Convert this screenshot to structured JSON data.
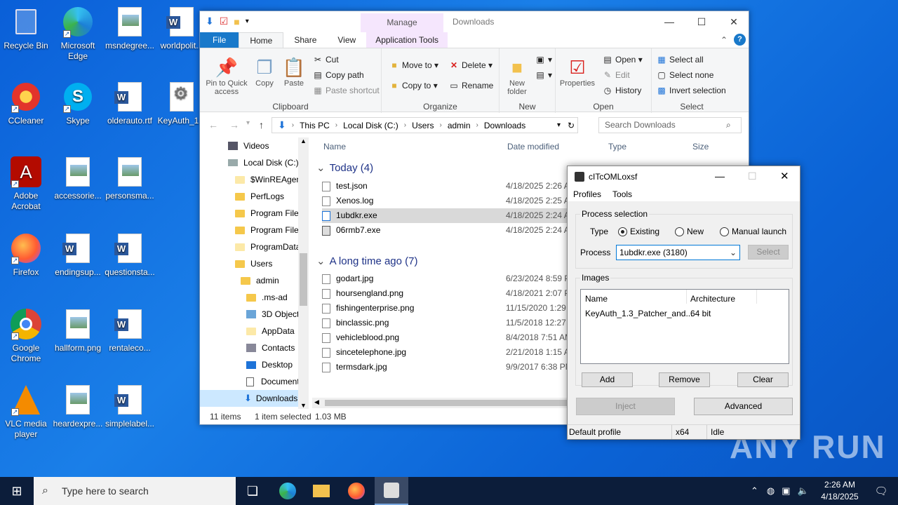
{
  "desktop": {
    "icons": [
      {
        "label": "Recycle Bin"
      },
      {
        "label": "Microsoft Edge"
      },
      {
        "label": "msndegree..."
      },
      {
        "label": "worldpolit..."
      },
      {
        "label": "CCleaner"
      },
      {
        "label": "Skype"
      },
      {
        "label": "olderauto.rtf"
      },
      {
        "label": "KeyAuth_1..."
      },
      {
        "label": "Adobe Acrobat"
      },
      {
        "label": "accessorie..."
      },
      {
        "label": "personsma..."
      },
      {
        "label": "Firefox"
      },
      {
        "label": "endingsup..."
      },
      {
        "label": "questionsta..."
      },
      {
        "label": "Google Chrome"
      },
      {
        "label": "hallform.png"
      },
      {
        "label": "rentaleco..."
      },
      {
        "label": "VLC media player"
      },
      {
        "label": "heardexpre..."
      },
      {
        "label": "simplelabel..."
      }
    ]
  },
  "explorer": {
    "title": "Downloads",
    "manage_tab": "Manage",
    "tabs": {
      "file": "File",
      "home": "Home",
      "share": "Share",
      "view": "View",
      "app_tools": "Application Tools"
    },
    "ribbon": {
      "pin": "Pin to Quick access",
      "copy": "Copy",
      "paste": "Paste",
      "cut": "Cut",
      "copy_path": "Copy path",
      "paste_shortcut": "Paste shortcut",
      "clipboard": "Clipboard",
      "move_to": "Move to",
      "copy_to": "Copy to",
      "delete": "Delete",
      "rename": "Rename",
      "organize": "Organize",
      "new_folder": "New folder",
      "new": "New",
      "properties": "Properties",
      "open": "Open",
      "edit": "Edit",
      "history": "History",
      "open_group": "Open",
      "select_all": "Select all",
      "select_none": "Select none",
      "invert_selection": "Invert selection",
      "select": "Select"
    },
    "address": {
      "parts": [
        "This PC",
        "Local Disk (C:)",
        "Users",
        "admin",
        "Downloads"
      ]
    },
    "search_placeholder": "Search Downloads",
    "nav": [
      "Videos",
      "Local Disk (C:)",
      "$WinREAgent",
      "PerfLogs",
      "Program Files",
      "Program Files",
      "ProgramData",
      "Users",
      "admin",
      ".ms-ad",
      "3D Objects",
      "AppData",
      "Contacts",
      "Desktop",
      "Documents",
      "Downloads"
    ],
    "columns": {
      "name": "Name",
      "date": "Date modified",
      "type": "Type",
      "size": "Size"
    },
    "groups": [
      {
        "title": "Today (4)",
        "files": [
          {
            "name": "test.json",
            "date": "4/18/2025 2:26 AM"
          },
          {
            "name": "Xenos.log",
            "date": "4/18/2025 2:25 AM"
          },
          {
            "name": "1ubdkr.exe",
            "date": "4/18/2025 2:24 AM"
          },
          {
            "name": "06rmb7.exe",
            "date": "4/18/2025 2:24 AM"
          }
        ]
      },
      {
        "title": "A long time ago (7)",
        "files": [
          {
            "name": "godart.jpg",
            "date": "6/23/2024 8:59 PM"
          },
          {
            "name": "hoursengland.png",
            "date": "4/18/2021 2:07 PM"
          },
          {
            "name": "fishingenterprise.png",
            "date": "11/15/2020 1:29 AM"
          },
          {
            "name": "binclassic.png",
            "date": "11/5/2018 12:27 AM"
          },
          {
            "name": "vehicleblood.png",
            "date": "8/4/2018 7:51 AM"
          },
          {
            "name": "sincetelephone.jpg",
            "date": "2/21/2018 1:15 AM"
          },
          {
            "name": "termsdark.jpg",
            "date": "9/9/2017 6:38 PM"
          }
        ]
      }
    ],
    "status": {
      "count": "11 items",
      "selected": "1 item selected",
      "size": "1.03 MB"
    }
  },
  "injector": {
    "title": "cITcOMLoxsf",
    "menu": [
      "Profiles",
      "Tools"
    ],
    "process_selection": "Process selection",
    "type_label": "Type",
    "radio_existing": "Existing",
    "radio_new": "New",
    "radio_manual": "Manual launch",
    "process_label": "Process",
    "process_value": "1ubdkr.exe (3180)",
    "select_btn": "Select",
    "images_label": "Images",
    "col_name": "Name",
    "col_arch": "Architecture",
    "image_name": "KeyAuth_1.3_Patcher_and...",
    "image_arch": "64 bit",
    "add": "Add",
    "remove": "Remove",
    "clear": "Clear",
    "inject": "Inject",
    "advanced": "Advanced",
    "status_profile": "Default profile",
    "status_arch": "x64",
    "status_state": "Idle"
  },
  "taskbar": {
    "search_placeholder": "Type here to search",
    "time": "2:26 AM",
    "date": "4/18/2025"
  },
  "watermark": "ANY RUN"
}
